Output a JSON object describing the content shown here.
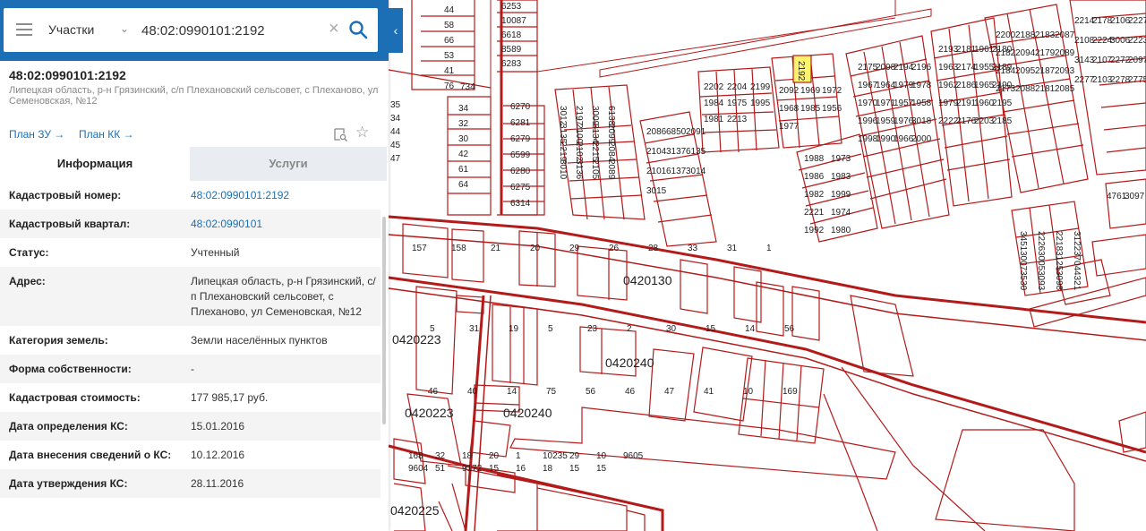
{
  "search": {
    "layer": "Участки",
    "query": "48:02:0990101:2192"
  },
  "object": {
    "title": "48:02:0990101:2192",
    "address": "Липецкая область, р-н Грязинский, с/п Плехановский сельсовет, с Плеханово, ул Семеновская, №12",
    "plan_zu": "План ЗУ →",
    "plan_kk": "План КК →"
  },
  "tabs": {
    "info": "Информация",
    "services": "Услуги"
  },
  "details": [
    {
      "label": "Кадастровый номер:",
      "value": "48:02:0990101:2192",
      "link": true
    },
    {
      "label": "Кадастровый квартал:",
      "value": "48:02:0990101",
      "link": true
    },
    {
      "label": "Статус:",
      "value": "Учтенный",
      "link": false
    },
    {
      "label": "Адрес:",
      "value": "Липецкая область, р-н Грязинский, с/п Плехановский сельсовет, с Плеханово, ул Семеновская, №12",
      "link": false
    },
    {
      "label": "Категория земель:",
      "value": "Земли населённых пунктов",
      "link": false
    },
    {
      "label": "Форма собственности:",
      "value": "-",
      "link": false
    },
    {
      "label": "Кадастровая стоимость:",
      "value": "177 985,17 руб.",
      "link": false
    },
    {
      "label": "Дата определения КС:",
      "value": "15.01.2016",
      "link": false
    },
    {
      "label": "Дата внесения сведений о КС:",
      "value": "10.12.2016",
      "link": false
    },
    {
      "label": "Дата утверждения КС:",
      "value": "28.11.2016",
      "link": false
    }
  ],
  "colors": {
    "accent": "#1c6fb5",
    "parcel_line": "#b31b1b",
    "selected_parcel": "#fff36b"
  },
  "map": {
    "quarter_labels": [
      "0420130",
      "0420223",
      "0420240",
      "0420240",
      "0420223",
      "0420225"
    ],
    "selected_label": "2192",
    "parcels_left": [
      "44",
      "58",
      "66",
      "53",
      "41",
      "76",
      "734",
      "34",
      "32",
      "30",
      "42",
      "61",
      "64",
      "35",
      "34",
      "44",
      "45",
      "47"
    ],
    "parcels_col": [
      "6253",
      "10087",
      "6618",
      "8589",
      "6283",
      "6270",
      "6281",
      "6279",
      "6599",
      "6280",
      "6275",
      "6314"
    ],
    "parcels_mid": [
      "3012",
      "2197",
      "3009",
      "6138",
      "3135",
      "2100",
      "3134",
      "2099",
      "2219",
      "2102",
      "2215",
      "2084",
      "3010",
      "3136",
      "2105",
      "2089",
      "2086",
      "6850",
      "2091",
      "2104",
      "3137",
      "6135",
      "2101",
      "6137",
      "3014",
      "3015"
    ],
    "parcels_center": [
      "2202",
      "2204",
      "2199",
      "1984",
      "1975",
      "1995",
      "1981",
      "2213",
      "2092",
      "1969",
      "1972",
      "1968",
      "1985",
      "1956",
      "1977",
      "1988",
      "1973",
      "1986",
      "1983",
      "1982",
      "1999",
      "2221",
      "1974",
      "1992",
      "1980"
    ],
    "parcels_right": [
      "2175",
      "2098",
      "2194",
      "2196",
      "1967",
      "1964",
      "1979",
      "1978",
      "1970",
      "1971",
      "1957",
      "1958",
      "1996",
      "1959",
      "1976",
      "3018",
      "1998",
      "1990",
      "1966",
      "2000",
      "2193",
      "2181",
      "1961",
      "2180",
      "1963",
      "2174",
      "1955",
      "2189",
      "1962",
      "2186",
      "1965",
      "2190",
      "1979",
      "2191",
      "1960",
      "2195",
      "2222",
      "2176",
      "2203",
      "2185",
      "2200",
      "2188",
      "2183",
      "2087",
      "2182",
      "2094",
      "2179",
      "2089",
      "2184",
      "2095",
      "2187",
      "2093",
      "2173",
      "2088",
      "2181",
      "2085"
    ],
    "parcels_far": [
      "2214",
      "2178",
      "2106",
      "2227",
      "2108",
      "2224",
      "3006",
      "2223",
      "3143",
      "2107",
      "2272",
      "2097",
      "2277",
      "2103",
      "2278",
      "2775",
      "3451",
      "2226",
      "2218",
      "3122",
      "3007",
      "3005",
      "3125",
      "3704",
      "3530",
      "3093",
      "3098",
      "4321",
      "4761",
      "3097"
    ],
    "parcels_bottom": [
      "157",
      "158",
      "21",
      "20",
      "29",
      "26",
      "28",
      "33",
      "31",
      "1",
      "5",
      "31",
      "19",
      "5",
      "23",
      "2",
      "30",
      "15",
      "14",
      "56",
      "46",
      "40",
      "14",
      "75",
      "56",
      "46",
      "47",
      "41",
      "10",
      "169",
      "168",
      "32",
      "18",
      "20",
      "1",
      "10235",
      "29",
      "10",
      "9605",
      "9604",
      "51",
      "9172",
      "15",
      "16",
      "18",
      "15",
      "15"
    ]
  }
}
